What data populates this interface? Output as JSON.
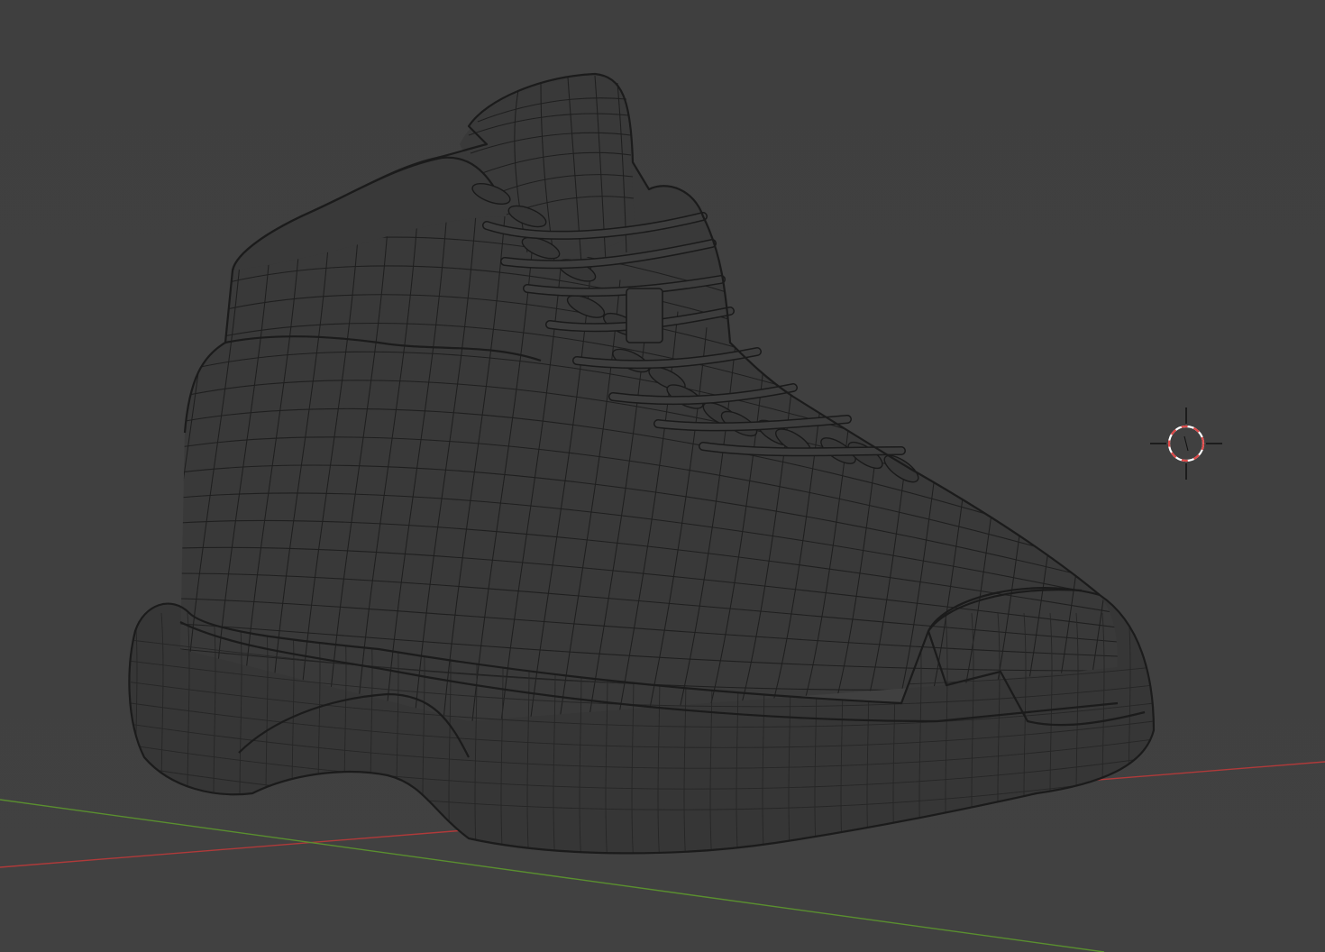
{
  "viewport": {
    "mode": "wireframe",
    "background_color": "#3f3f3f",
    "object": "sneaker-mesh",
    "mesh_fill_color": "#393939",
    "wire_color": "#1f1f1f",
    "axes": {
      "x_axis_color": "#b03a3a",
      "y_axis_color": "#5a8f2f"
    },
    "cursor_3d": {
      "ring_colors": [
        "#e04848",
        "#ffffff"
      ],
      "crosshair_color": "#111111"
    }
  }
}
